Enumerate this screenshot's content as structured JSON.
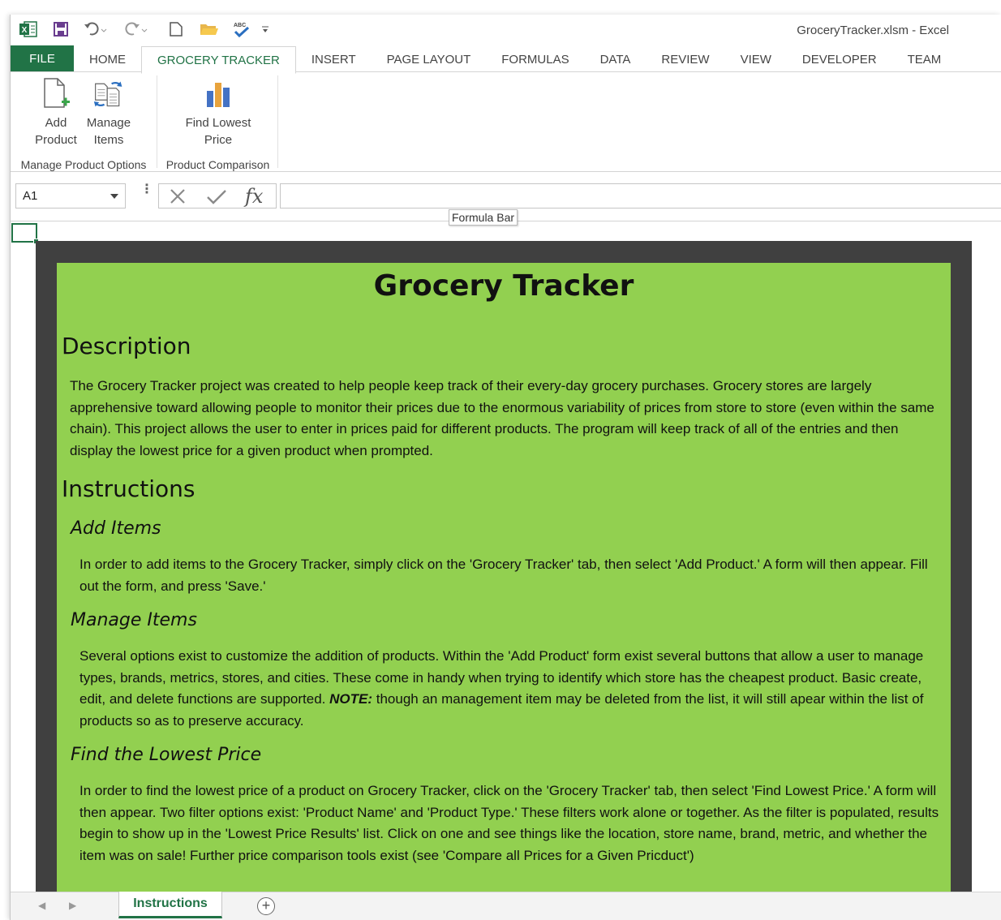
{
  "window": {
    "title": "GroceryTracker.xlsm - Excel"
  },
  "tabs": [
    {
      "label": "FILE"
    },
    {
      "label": "HOME"
    },
    {
      "label": "GROCERY TRACKER"
    },
    {
      "label": "INSERT"
    },
    {
      "label": "PAGE LAYOUT"
    },
    {
      "label": "FORMULAS"
    },
    {
      "label": "DATA"
    },
    {
      "label": "REVIEW"
    },
    {
      "label": "VIEW"
    },
    {
      "label": "DEVELOPER"
    },
    {
      "label": "TEAM"
    }
  ],
  "ribbon": {
    "groups": [
      {
        "label": "Manage Product Options",
        "buttons": [
          {
            "line1": "Add",
            "line2": "Product",
            "icon": "add-product-icon"
          },
          {
            "line1": "Manage",
            "line2": "Items",
            "icon": "manage-items-icon"
          }
        ]
      },
      {
        "label": "Product Comparison",
        "buttons": [
          {
            "line1": "Find Lowest",
            "line2": "Price",
            "icon": "bar-chart-icon"
          }
        ]
      }
    ]
  },
  "formula_bar": {
    "name_box": "A1",
    "tooltip": "Formula Bar",
    "fx": "fx"
  },
  "content": {
    "title": "Grocery Tracker",
    "description_heading": "Description",
    "description": "The Grocery Tracker project was created to help people keep track of their every-day grocery purchases. Grocery stores are largely apprehensive toward allowing people to monitor their prices due to the enormous variability of prices from store to store (even within the same chain). This project allows the user to enter in prices paid for different products. The program will keep track of all of the entries and then display the lowest price for a given product when prompted.",
    "instructions_heading": "Instructions",
    "add_items_heading": "Add Items",
    "add_items_text": "In order to add items to the Grocery Tracker, simply click on the 'Grocery Tracker' tab, then select 'Add Product.' A form will then appear. Fill out the form, and press 'Save.'",
    "manage_items_heading": "Manage Items",
    "manage_items_text_before": "Several options exist to customize the addition of products. Within the 'Add Product' form exist several buttons that allow a user to manage types, brands, metrics, stores, and cities. These come in handy when trying to identify which store has the cheapest product. Basic create, edit, and delete functions are supported.",
    "manage_items_note_label": "NOTE:",
    "manage_items_text_after": "though an management item may be deleted from the list, it will still apear within the list of products so as to preserve accuracy.",
    "find_lowest_heading": "Find the Lowest Price",
    "find_lowest_text": "In order to find the lowest price of a product on Grocery Tracker, click on the 'Grocery Tracker' tab, then select 'Find Lowest Price.' A form will then appear. Two filter options exist: 'Product Name' and 'Product Type.' These filters work alone or together. As the filter is populated, results begin to show up in the 'Lowest Price Results' list. Click on one and see things like the location, store name, brand, metric, and whether the item was on sale! Further price comparison tools exist (see 'Compare all Prices for a Given Pricduct')"
  },
  "sheets": [
    {
      "label": "Instructions"
    }
  ],
  "colors": {
    "excel_green": "#217346",
    "panel_green": "#92d050",
    "frame_dark": "#404040"
  }
}
